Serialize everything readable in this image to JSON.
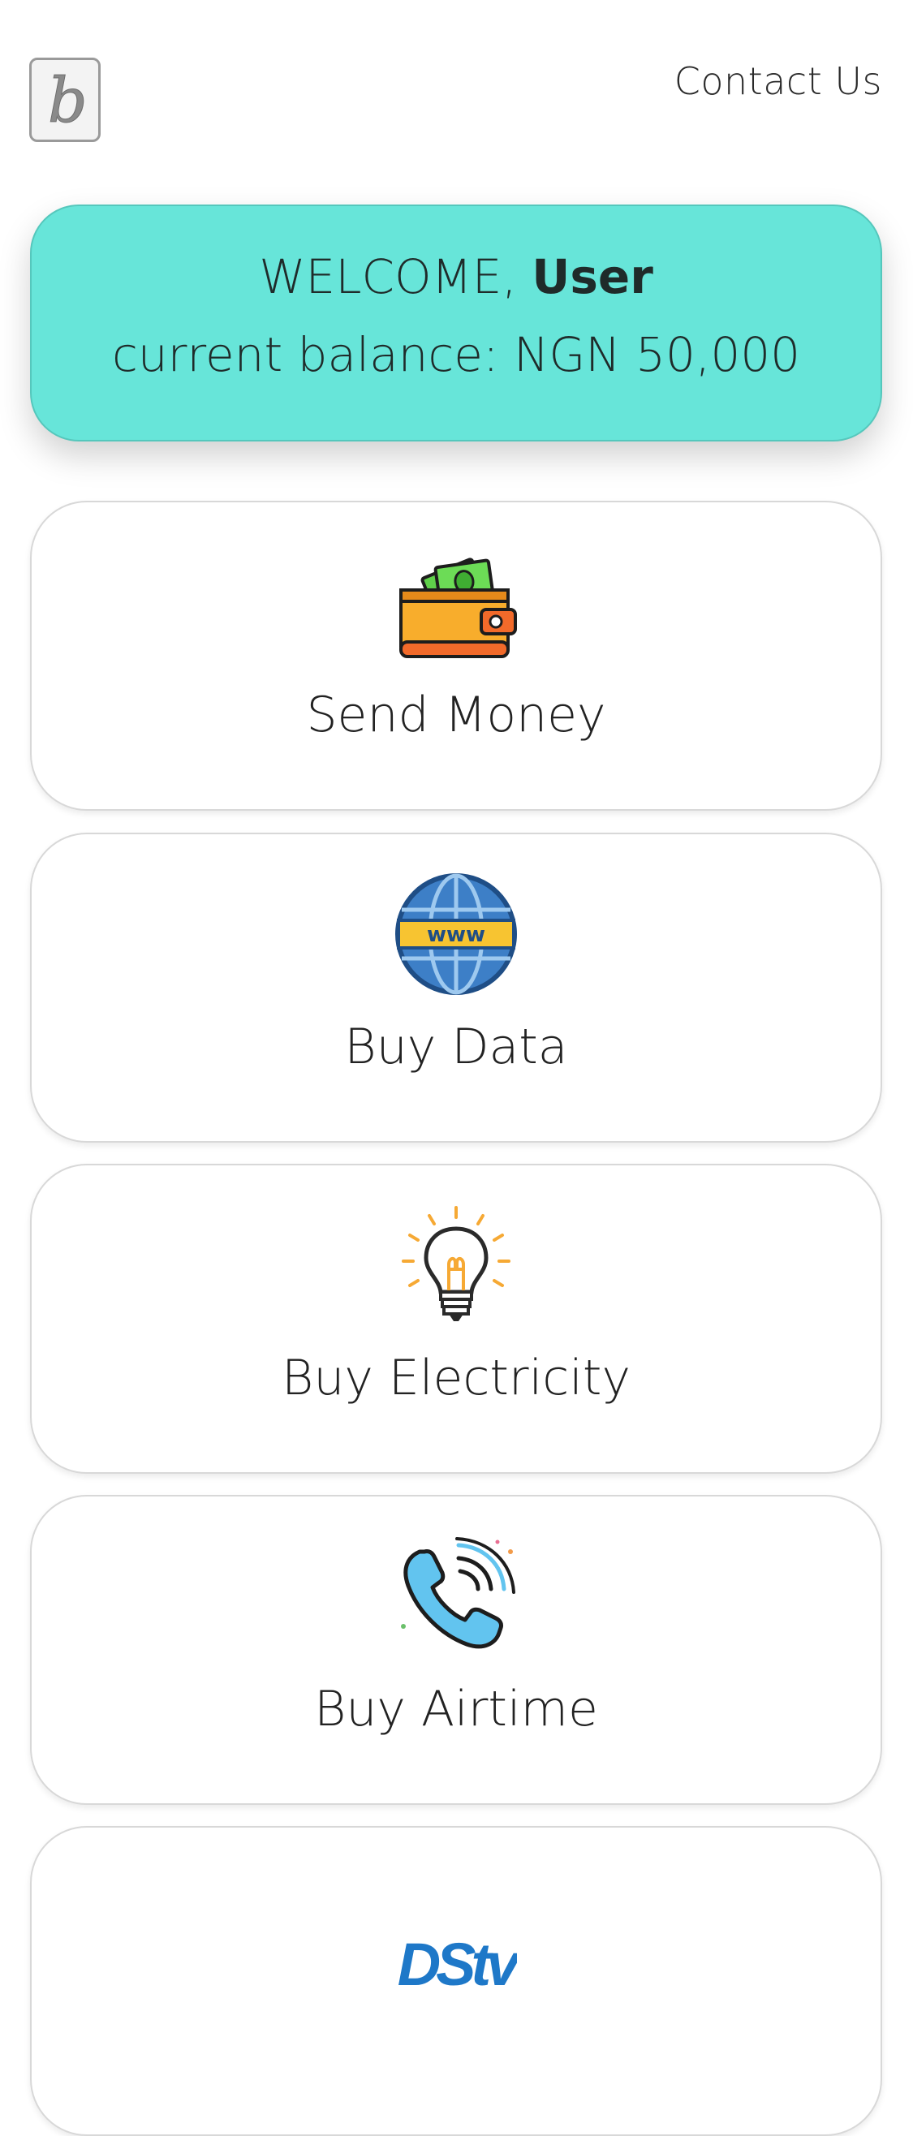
{
  "header": {
    "logo_letter": "b",
    "contact_label": "Contact Us"
  },
  "welcome": {
    "greeting": "WELCOME, ",
    "user_name": "User",
    "balance_label": "current balance: NGN 50,000"
  },
  "services": [
    {
      "label": "Send Money",
      "icon": "wallet-icon"
    },
    {
      "label": "Buy Data",
      "icon": "globe-www-icon"
    },
    {
      "label": "Buy Electricity",
      "icon": "lightbulb-icon"
    },
    {
      "label": "Buy Airtime",
      "icon": "phone-icon"
    },
    {
      "label": "",
      "icon": "dstv-logo-icon",
      "logo_text": "DStv"
    }
  ],
  "colors": {
    "accent": "#67e5d9",
    "text": "#262626"
  }
}
